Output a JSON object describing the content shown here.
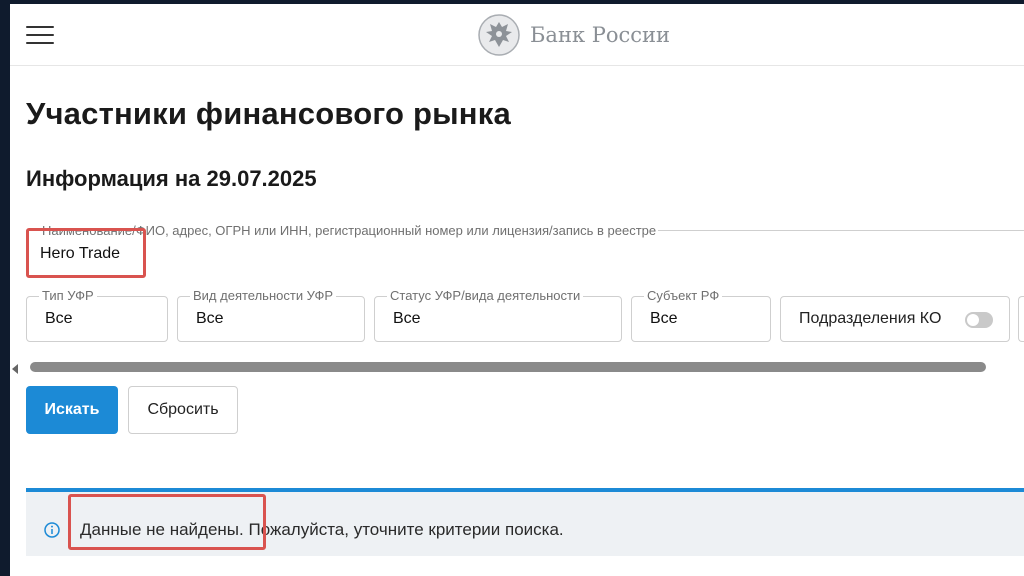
{
  "header": {
    "brand_name": "Банк России",
    "menu_icon": "hamburger-menu-icon",
    "logo_icon": "double-headed-eagle-emblem"
  },
  "page": {
    "title": "Участники финансового рынка",
    "info_date": "Информация на 29.07.2025"
  },
  "search": {
    "label": "Наименование/ФИО, адрес, ОГРН или ИНН, регистрационный номер или лицензия/запись в реестре",
    "value": "Hero Trade"
  },
  "filters": [
    {
      "label": "Тип УФР",
      "value": "Все"
    },
    {
      "label": "Вид деятельности УФР",
      "value": "Все"
    },
    {
      "label": "Статус УФР/вида деятельности",
      "value": "Все"
    },
    {
      "label": "Субъект РФ",
      "value": "Все"
    }
  ],
  "toggle": {
    "label": "Подразделения КО",
    "state": "off"
  },
  "actions": {
    "search_label": "Искать",
    "reset_label": "Сбросить"
  },
  "alert": {
    "icon": "info-icon",
    "text": "Данные не найдены. Пожалуйста, уточните критерии поиска."
  },
  "colors": {
    "accent": "#1c8ad6",
    "highlight": "#d9534f",
    "alert_bg": "#eef1f4"
  }
}
